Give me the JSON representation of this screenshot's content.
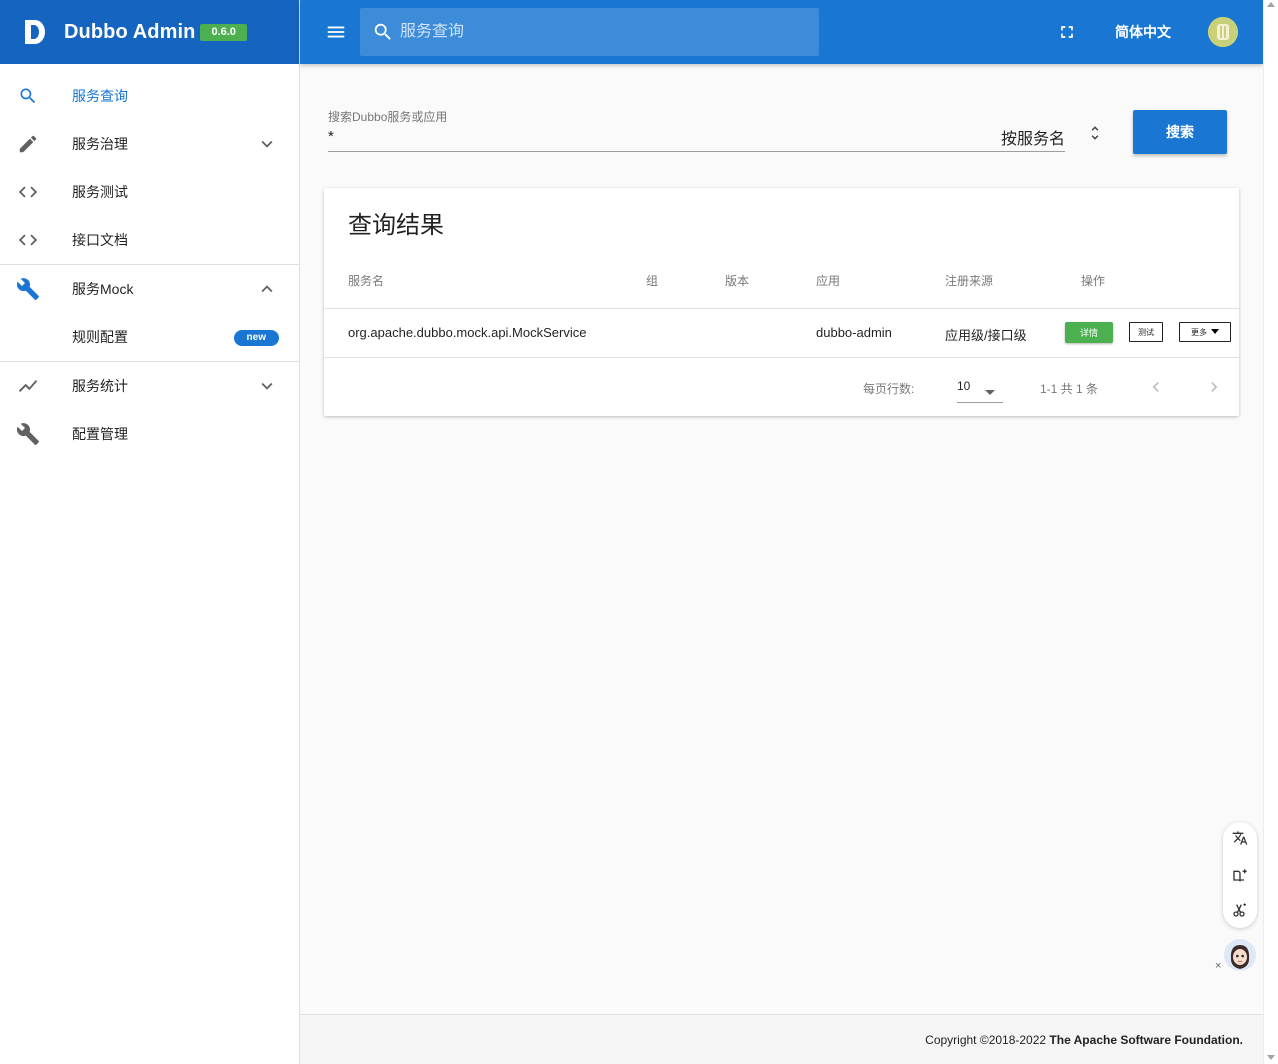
{
  "brand": {
    "title": "Dubbo Admin",
    "version": "0.6.0"
  },
  "topbar": {
    "search_placeholder": "服务查询",
    "language": "简体中文"
  },
  "sidebar": {
    "items": [
      {
        "label": "服务查询",
        "icon": "search-icon",
        "active": true
      },
      {
        "label": "服务治理",
        "icon": "pencil-icon",
        "chevron": "down"
      },
      {
        "label": "服务测试",
        "icon": "code-icon"
      },
      {
        "label": "接口文档",
        "icon": "code-icon"
      },
      {
        "label": "服务Mock",
        "icon": "wrench-icon",
        "chevron": "up"
      },
      {
        "label": "规则配置",
        "badge": "new",
        "sub": true
      },
      {
        "label": "服务统计",
        "icon": "trending-up-icon",
        "chevron": "down"
      },
      {
        "label": "配置管理",
        "icon": "wrench-icon"
      }
    ]
  },
  "search": {
    "label": "搜索Dubbo服务或应用",
    "value": "*",
    "type": "按服务名",
    "button": "搜索"
  },
  "results": {
    "title": "查询结果",
    "headers": [
      "服务名",
      "组",
      "版本",
      "应用",
      "注册来源",
      "操作"
    ],
    "rows": [
      {
        "service": "org.apache.dubbo.mock.api.MockService",
        "group": "",
        "version": "",
        "app": "dubbo-admin",
        "source": "应用级/接口级",
        "actions": {
          "detail": "详情",
          "test": "测试",
          "more": "更多"
        }
      }
    ],
    "pager": {
      "rows_label": "每页行数:",
      "rows_per_page": "10",
      "range": "1-1 共 1 条"
    }
  },
  "footer": {
    "prefix": "Copyright ©2018-2022",
    "org": "The Apache Software Foundation."
  },
  "colors": {
    "primary": "#1976d2",
    "brand_bg": "#1565c0",
    "success": "#4caf50"
  }
}
